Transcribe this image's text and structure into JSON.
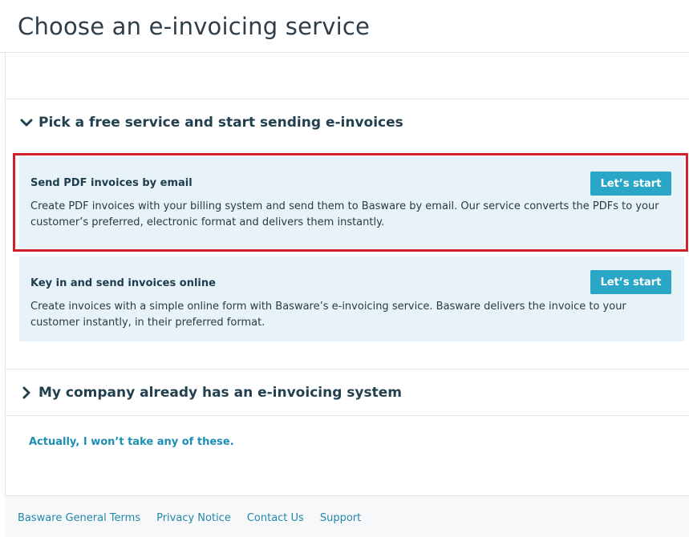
{
  "header": {
    "title": "Choose an e-invoicing service"
  },
  "sections": {
    "free_service": {
      "label": "Pick a free service and start sending e-invoices",
      "expanded": true,
      "icon": "chevron-down-icon"
    },
    "existing_system": {
      "label": "My company already has an e-invoicing system",
      "expanded": false,
      "icon": "chevron-right-icon"
    }
  },
  "options": [
    {
      "title": "Send PDF invoices by email",
      "description": "Create PDF invoices with your billing system and send them to Basware by email. Our service converts the PDFs to your customer’s preferred, electronic format and delivers them instantly.",
      "button_label": "Let’s start",
      "highlighted": true
    },
    {
      "title": "Key in and send invoices online",
      "description": "Create invoices with a simple online form with Basware’s e-invoicing service. Basware delivers the invoice to your customer instantly, in their preferred format.",
      "button_label": "Let’s start",
      "highlighted": false
    }
  ],
  "decline_link": "Actually, I won’t take any of these.",
  "footer": {
    "links": [
      "Basware General Terms",
      "Privacy Notice",
      "Contact Us",
      "Support"
    ]
  },
  "colors": {
    "accent": "#2aa7c6",
    "card_bg": "#e7f3f9",
    "highlight_border": "#d0202b",
    "link": "#1c8fb3"
  }
}
